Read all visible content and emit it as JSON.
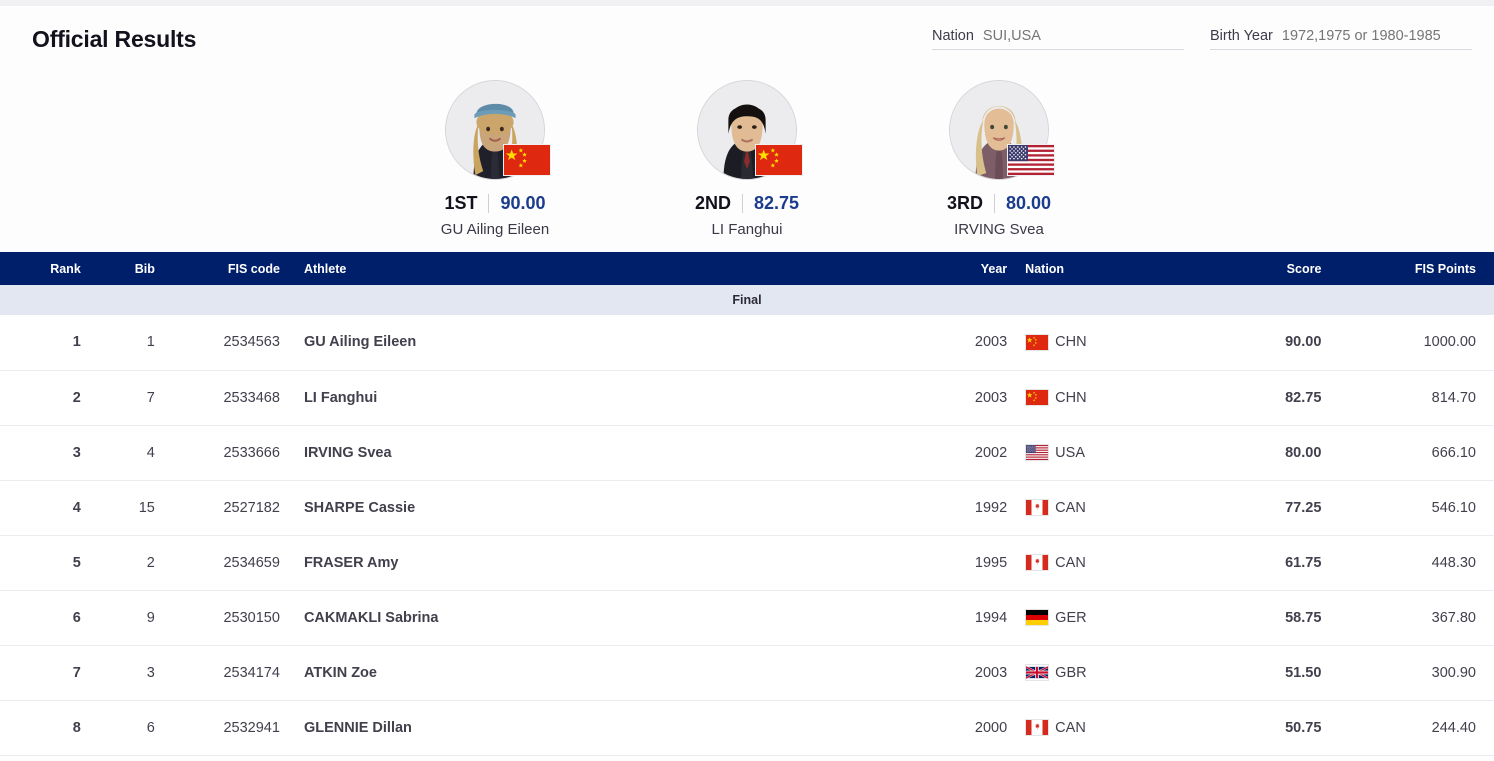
{
  "header": {
    "title": "Official Results",
    "filters": [
      {
        "name": "nation",
        "label": "Nation",
        "value": "",
        "placeholder": "SUI,USA"
      },
      {
        "name": "birth-year",
        "label": "Birth Year",
        "value": "",
        "placeholder": "1972,1975 or 1980-1985"
      }
    ]
  },
  "podium": [
    {
      "rank": "1ST",
      "score": "90.00",
      "name": "GU Ailing Eileen",
      "flag": "CHN"
    },
    {
      "rank": "2ND",
      "score": "82.75",
      "name": "LI Fanghui",
      "flag": "CHN"
    },
    {
      "rank": "3RD",
      "score": "80.00",
      "name": "IRVING Svea",
      "flag": "USA"
    }
  ],
  "table": {
    "columns": {
      "rank": "Rank",
      "bib": "Bib",
      "fis_code": "FIS code",
      "athlete": "Athlete",
      "year": "Year",
      "nation": "Nation",
      "score": "Score",
      "fis_points": "FIS Points"
    },
    "section_label": "Final",
    "rows": [
      {
        "rank": "1",
        "bib": "1",
        "fis_code": "2534563",
        "athlete": "GU Ailing Eileen",
        "year": "2003",
        "nation": "CHN",
        "score": "90.00",
        "fis_points": "1000.00"
      },
      {
        "rank": "2",
        "bib": "7",
        "fis_code": "2533468",
        "athlete": "LI Fanghui",
        "year": "2003",
        "nation": "CHN",
        "score": "82.75",
        "fis_points": "814.70"
      },
      {
        "rank": "3",
        "bib": "4",
        "fis_code": "2533666",
        "athlete": "IRVING Svea",
        "year": "2002",
        "nation": "USA",
        "score": "80.00",
        "fis_points": "666.10"
      },
      {
        "rank": "4",
        "bib": "15",
        "fis_code": "2527182",
        "athlete": "SHARPE Cassie",
        "year": "1992",
        "nation": "CAN",
        "score": "77.25",
        "fis_points": "546.10"
      },
      {
        "rank": "5",
        "bib": "2",
        "fis_code": "2534659",
        "athlete": "FRASER Amy",
        "year": "1995",
        "nation": "CAN",
        "score": "61.75",
        "fis_points": "448.30"
      },
      {
        "rank": "6",
        "bib": "9",
        "fis_code": "2530150",
        "athlete": "CAKMAKLI Sabrina",
        "year": "1994",
        "nation": "GER",
        "score": "58.75",
        "fis_points": "367.80"
      },
      {
        "rank": "7",
        "bib": "3",
        "fis_code": "2534174",
        "athlete": "ATKIN Zoe",
        "year": "2003",
        "nation": "GBR",
        "score": "51.50",
        "fis_points": "300.90"
      },
      {
        "rank": "8",
        "bib": "6",
        "fis_code": "2532941",
        "athlete": "GLENNIE Dillan",
        "year": "2000",
        "nation": "CAN",
        "score": "50.75",
        "fis_points": "244.40"
      }
    ]
  },
  "colors": {
    "table_header_bg": "#001f6b",
    "section_bg": "#e3e7f2",
    "score_text": "#1b3c8c",
    "page_bg": "#f1f1f4"
  }
}
